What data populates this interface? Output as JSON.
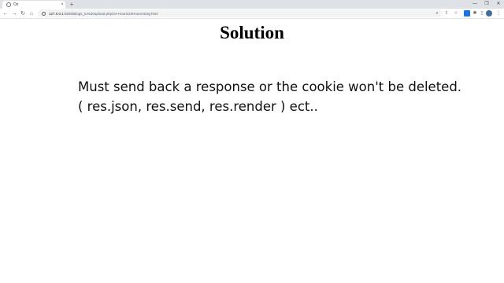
{
  "browser": {
    "tab": {
      "title": "Ox",
      "close": "×"
    },
    "new_tab": "+",
    "window_controls": {
      "minimize": "—",
      "restore": "❐",
      "close": "✕"
    },
    "nav": {
      "back": "←",
      "forward": "→",
      "reload": "↻",
      "home": "⌂"
    },
    "url_host": "127.0.0.1",
    "url_path": ":5500/Blogs_to%20upload.php/24-Hours/24HoursADay.html"
  },
  "page": {
    "title": "Solution",
    "line1": "Must send back a response or the cookie won't be deleted.",
    "line2": "( res.json, res.send, res.render ) ect.."
  }
}
